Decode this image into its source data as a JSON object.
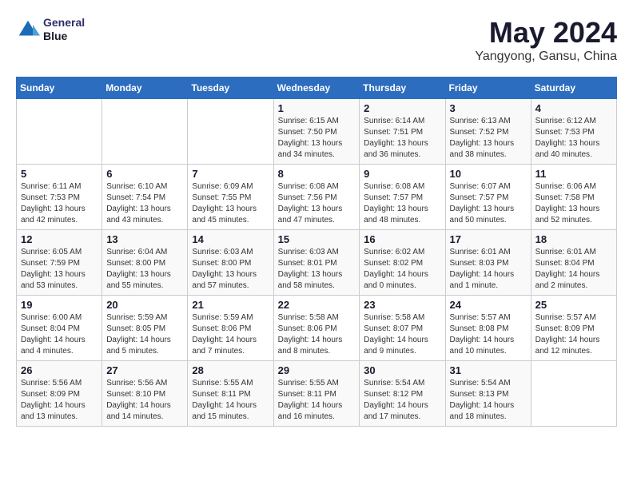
{
  "header": {
    "logo_line1": "General",
    "logo_line2": "Blue",
    "title": "May 2024",
    "subtitle": "Yangyong, Gansu, China"
  },
  "weekdays": [
    "Sunday",
    "Monday",
    "Tuesday",
    "Wednesday",
    "Thursday",
    "Friday",
    "Saturday"
  ],
  "weeks": [
    [
      {
        "day": "",
        "info": ""
      },
      {
        "day": "",
        "info": ""
      },
      {
        "day": "",
        "info": ""
      },
      {
        "day": "1",
        "info": "Sunrise: 6:15 AM\nSunset: 7:50 PM\nDaylight: 13 hours\nand 34 minutes."
      },
      {
        "day": "2",
        "info": "Sunrise: 6:14 AM\nSunset: 7:51 PM\nDaylight: 13 hours\nand 36 minutes."
      },
      {
        "day": "3",
        "info": "Sunrise: 6:13 AM\nSunset: 7:52 PM\nDaylight: 13 hours\nand 38 minutes."
      },
      {
        "day": "4",
        "info": "Sunrise: 6:12 AM\nSunset: 7:53 PM\nDaylight: 13 hours\nand 40 minutes."
      }
    ],
    [
      {
        "day": "5",
        "info": "Sunrise: 6:11 AM\nSunset: 7:53 PM\nDaylight: 13 hours\nand 42 minutes."
      },
      {
        "day": "6",
        "info": "Sunrise: 6:10 AM\nSunset: 7:54 PM\nDaylight: 13 hours\nand 43 minutes."
      },
      {
        "day": "7",
        "info": "Sunrise: 6:09 AM\nSunset: 7:55 PM\nDaylight: 13 hours\nand 45 minutes."
      },
      {
        "day": "8",
        "info": "Sunrise: 6:08 AM\nSunset: 7:56 PM\nDaylight: 13 hours\nand 47 minutes."
      },
      {
        "day": "9",
        "info": "Sunrise: 6:08 AM\nSunset: 7:57 PM\nDaylight: 13 hours\nand 48 minutes."
      },
      {
        "day": "10",
        "info": "Sunrise: 6:07 AM\nSunset: 7:57 PM\nDaylight: 13 hours\nand 50 minutes."
      },
      {
        "day": "11",
        "info": "Sunrise: 6:06 AM\nSunset: 7:58 PM\nDaylight: 13 hours\nand 52 minutes."
      }
    ],
    [
      {
        "day": "12",
        "info": "Sunrise: 6:05 AM\nSunset: 7:59 PM\nDaylight: 13 hours\nand 53 minutes."
      },
      {
        "day": "13",
        "info": "Sunrise: 6:04 AM\nSunset: 8:00 PM\nDaylight: 13 hours\nand 55 minutes."
      },
      {
        "day": "14",
        "info": "Sunrise: 6:03 AM\nSunset: 8:00 PM\nDaylight: 13 hours\nand 57 minutes."
      },
      {
        "day": "15",
        "info": "Sunrise: 6:03 AM\nSunset: 8:01 PM\nDaylight: 13 hours\nand 58 minutes."
      },
      {
        "day": "16",
        "info": "Sunrise: 6:02 AM\nSunset: 8:02 PM\nDaylight: 14 hours\nand 0 minutes."
      },
      {
        "day": "17",
        "info": "Sunrise: 6:01 AM\nSunset: 8:03 PM\nDaylight: 14 hours\nand 1 minute."
      },
      {
        "day": "18",
        "info": "Sunrise: 6:01 AM\nSunset: 8:04 PM\nDaylight: 14 hours\nand 2 minutes."
      }
    ],
    [
      {
        "day": "19",
        "info": "Sunrise: 6:00 AM\nSunset: 8:04 PM\nDaylight: 14 hours\nand 4 minutes."
      },
      {
        "day": "20",
        "info": "Sunrise: 5:59 AM\nSunset: 8:05 PM\nDaylight: 14 hours\nand 5 minutes."
      },
      {
        "day": "21",
        "info": "Sunrise: 5:59 AM\nSunset: 8:06 PM\nDaylight: 14 hours\nand 7 minutes."
      },
      {
        "day": "22",
        "info": "Sunrise: 5:58 AM\nSunset: 8:06 PM\nDaylight: 14 hours\nand 8 minutes."
      },
      {
        "day": "23",
        "info": "Sunrise: 5:58 AM\nSunset: 8:07 PM\nDaylight: 14 hours\nand 9 minutes."
      },
      {
        "day": "24",
        "info": "Sunrise: 5:57 AM\nSunset: 8:08 PM\nDaylight: 14 hours\nand 10 minutes."
      },
      {
        "day": "25",
        "info": "Sunrise: 5:57 AM\nSunset: 8:09 PM\nDaylight: 14 hours\nand 12 minutes."
      }
    ],
    [
      {
        "day": "26",
        "info": "Sunrise: 5:56 AM\nSunset: 8:09 PM\nDaylight: 14 hours\nand 13 minutes."
      },
      {
        "day": "27",
        "info": "Sunrise: 5:56 AM\nSunset: 8:10 PM\nDaylight: 14 hours\nand 14 minutes."
      },
      {
        "day": "28",
        "info": "Sunrise: 5:55 AM\nSunset: 8:11 PM\nDaylight: 14 hours\nand 15 minutes."
      },
      {
        "day": "29",
        "info": "Sunrise: 5:55 AM\nSunset: 8:11 PM\nDaylight: 14 hours\nand 16 minutes."
      },
      {
        "day": "30",
        "info": "Sunrise: 5:54 AM\nSunset: 8:12 PM\nDaylight: 14 hours\nand 17 minutes."
      },
      {
        "day": "31",
        "info": "Sunrise: 5:54 AM\nSunset: 8:13 PM\nDaylight: 14 hours\nand 18 minutes."
      },
      {
        "day": "",
        "info": ""
      }
    ]
  ]
}
